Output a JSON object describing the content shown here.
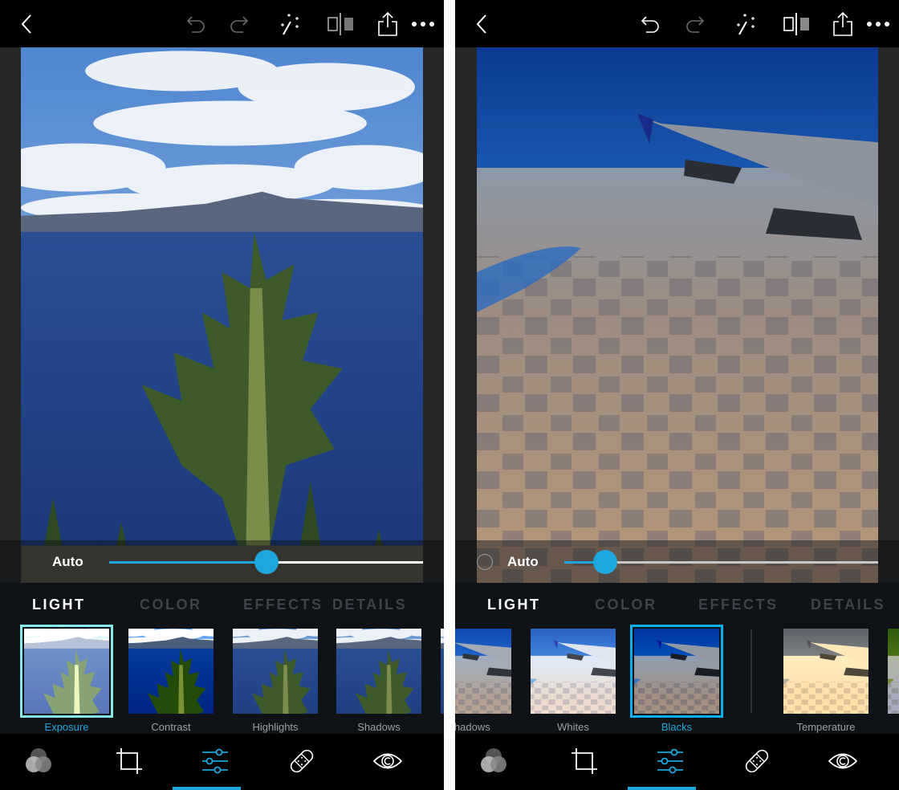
{
  "colors": {
    "accent": "#1da7dc",
    "topbar_bg": "#000000",
    "panel_bg": "#262626",
    "tabbar_bg": "#0f1216",
    "tab_inactive": "#3e434a",
    "thumb_label": "#9aa0a6"
  },
  "screens": [
    {
      "topbar": {
        "icons": [
          "back-chevron-icon",
          "undo-icon",
          "redo-icon",
          "magic-wand-icon",
          "compare-icon",
          "share-icon",
          "more-icon"
        ],
        "undo_enabled": false,
        "redo_enabled": false
      },
      "photo": {
        "subject": "Crater Lake with a tall pine tree in the foreground"
      },
      "adjust": {
        "auto_label": "Auto",
        "auto_radio_visible": false,
        "slider_value_fraction": 0.5
      },
      "tabs": [
        {
          "label": "LIGHT",
          "active": true
        },
        {
          "label": "COLOR",
          "active": false
        },
        {
          "label": "EFFECTS",
          "active": false
        },
        {
          "label": "DETAILS",
          "active": false
        }
      ],
      "thumbnails": [
        {
          "label": "Exposure",
          "selected": true
        },
        {
          "label": "Contrast",
          "selected": false
        },
        {
          "label": "Highlights",
          "selected": false
        },
        {
          "label": "Shadows",
          "selected": false
        },
        {
          "label": "",
          "selected": false
        }
      ],
      "toolbar": {
        "tools": [
          {
            "name": "looks",
            "icon": "overlapping-circles-icon",
            "active": false
          },
          {
            "name": "crop",
            "icon": "crop-icon",
            "active": false
          },
          {
            "name": "adjustments",
            "icon": "sliders-icon",
            "active": true
          },
          {
            "name": "healing",
            "icon": "bandage-icon",
            "active": false
          },
          {
            "name": "red-eye",
            "icon": "eye-icon",
            "active": false
          }
        ]
      }
    },
    {
      "topbar": {
        "icons": [
          "back-chevron-icon",
          "undo-icon",
          "redo-icon",
          "magic-wand-icon",
          "compare-icon",
          "share-icon",
          "more-icon"
        ],
        "undo_enabled": true,
        "redo_enabled": false
      },
      "photo": {
        "subject": "Airplane wing over patchwork farmland"
      },
      "adjust": {
        "auto_label": "Auto",
        "auto_radio_visible": true,
        "slider_value_fraction": 0.13
      },
      "tabs": [
        {
          "label": "LIGHT",
          "active": true
        },
        {
          "label": "COLOR",
          "active": false
        },
        {
          "label": "EFFECTS",
          "active": false
        },
        {
          "label": "DETAILS",
          "active": false
        }
      ],
      "thumbnails": [
        {
          "label": "Shadows",
          "selected": false
        },
        {
          "label": "Whites",
          "selected": false
        },
        {
          "label": "Blacks",
          "selected": true
        },
        {
          "label": "Temperature",
          "selected": false
        },
        {
          "label": "",
          "selected": false
        }
      ],
      "toolbar": {
        "tools": [
          {
            "name": "looks",
            "icon": "overlapping-circles-icon",
            "active": false
          },
          {
            "name": "crop",
            "icon": "crop-icon",
            "active": false
          },
          {
            "name": "adjustments",
            "icon": "sliders-icon",
            "active": true
          },
          {
            "name": "healing",
            "icon": "bandage-icon",
            "active": false
          },
          {
            "name": "red-eye",
            "icon": "eye-icon",
            "active": false
          }
        ]
      }
    }
  ]
}
